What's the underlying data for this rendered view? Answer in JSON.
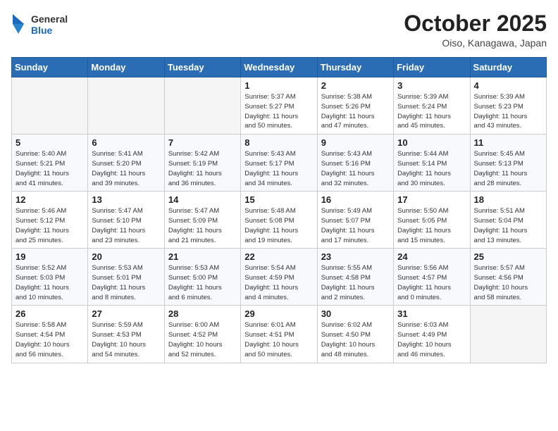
{
  "header": {
    "logo_general": "General",
    "logo_blue": "Blue",
    "month_title": "October 2025",
    "location": "Oiso, Kanagawa, Japan"
  },
  "weekdays": [
    "Sunday",
    "Monday",
    "Tuesday",
    "Wednesday",
    "Thursday",
    "Friday",
    "Saturday"
  ],
  "weeks": [
    [
      {
        "day": "",
        "info": ""
      },
      {
        "day": "",
        "info": ""
      },
      {
        "day": "",
        "info": ""
      },
      {
        "day": "1",
        "info": "Sunrise: 5:37 AM\nSunset: 5:27 PM\nDaylight: 11 hours\nand 50 minutes."
      },
      {
        "day": "2",
        "info": "Sunrise: 5:38 AM\nSunset: 5:26 PM\nDaylight: 11 hours\nand 47 minutes."
      },
      {
        "day": "3",
        "info": "Sunrise: 5:39 AM\nSunset: 5:24 PM\nDaylight: 11 hours\nand 45 minutes."
      },
      {
        "day": "4",
        "info": "Sunrise: 5:39 AM\nSunset: 5:23 PM\nDaylight: 11 hours\nand 43 minutes."
      }
    ],
    [
      {
        "day": "5",
        "info": "Sunrise: 5:40 AM\nSunset: 5:21 PM\nDaylight: 11 hours\nand 41 minutes."
      },
      {
        "day": "6",
        "info": "Sunrise: 5:41 AM\nSunset: 5:20 PM\nDaylight: 11 hours\nand 39 minutes."
      },
      {
        "day": "7",
        "info": "Sunrise: 5:42 AM\nSunset: 5:19 PM\nDaylight: 11 hours\nand 36 minutes."
      },
      {
        "day": "8",
        "info": "Sunrise: 5:43 AM\nSunset: 5:17 PM\nDaylight: 11 hours\nand 34 minutes."
      },
      {
        "day": "9",
        "info": "Sunrise: 5:43 AM\nSunset: 5:16 PM\nDaylight: 11 hours\nand 32 minutes."
      },
      {
        "day": "10",
        "info": "Sunrise: 5:44 AM\nSunset: 5:14 PM\nDaylight: 11 hours\nand 30 minutes."
      },
      {
        "day": "11",
        "info": "Sunrise: 5:45 AM\nSunset: 5:13 PM\nDaylight: 11 hours\nand 28 minutes."
      }
    ],
    [
      {
        "day": "12",
        "info": "Sunrise: 5:46 AM\nSunset: 5:12 PM\nDaylight: 11 hours\nand 25 minutes."
      },
      {
        "day": "13",
        "info": "Sunrise: 5:47 AM\nSunset: 5:10 PM\nDaylight: 11 hours\nand 23 minutes."
      },
      {
        "day": "14",
        "info": "Sunrise: 5:47 AM\nSunset: 5:09 PM\nDaylight: 11 hours\nand 21 minutes."
      },
      {
        "day": "15",
        "info": "Sunrise: 5:48 AM\nSunset: 5:08 PM\nDaylight: 11 hours\nand 19 minutes."
      },
      {
        "day": "16",
        "info": "Sunrise: 5:49 AM\nSunset: 5:07 PM\nDaylight: 11 hours\nand 17 minutes."
      },
      {
        "day": "17",
        "info": "Sunrise: 5:50 AM\nSunset: 5:05 PM\nDaylight: 11 hours\nand 15 minutes."
      },
      {
        "day": "18",
        "info": "Sunrise: 5:51 AM\nSunset: 5:04 PM\nDaylight: 11 hours\nand 13 minutes."
      }
    ],
    [
      {
        "day": "19",
        "info": "Sunrise: 5:52 AM\nSunset: 5:03 PM\nDaylight: 11 hours\nand 10 minutes."
      },
      {
        "day": "20",
        "info": "Sunrise: 5:53 AM\nSunset: 5:01 PM\nDaylight: 11 hours\nand 8 minutes."
      },
      {
        "day": "21",
        "info": "Sunrise: 5:53 AM\nSunset: 5:00 PM\nDaylight: 11 hours\nand 6 minutes."
      },
      {
        "day": "22",
        "info": "Sunrise: 5:54 AM\nSunset: 4:59 PM\nDaylight: 11 hours\nand 4 minutes."
      },
      {
        "day": "23",
        "info": "Sunrise: 5:55 AM\nSunset: 4:58 PM\nDaylight: 11 hours\nand 2 minutes."
      },
      {
        "day": "24",
        "info": "Sunrise: 5:56 AM\nSunset: 4:57 PM\nDaylight: 11 hours\nand 0 minutes."
      },
      {
        "day": "25",
        "info": "Sunrise: 5:57 AM\nSunset: 4:56 PM\nDaylight: 10 hours\nand 58 minutes."
      }
    ],
    [
      {
        "day": "26",
        "info": "Sunrise: 5:58 AM\nSunset: 4:54 PM\nDaylight: 10 hours\nand 56 minutes."
      },
      {
        "day": "27",
        "info": "Sunrise: 5:59 AM\nSunset: 4:53 PM\nDaylight: 10 hours\nand 54 minutes."
      },
      {
        "day": "28",
        "info": "Sunrise: 6:00 AM\nSunset: 4:52 PM\nDaylight: 10 hours\nand 52 minutes."
      },
      {
        "day": "29",
        "info": "Sunrise: 6:01 AM\nSunset: 4:51 PM\nDaylight: 10 hours\nand 50 minutes."
      },
      {
        "day": "30",
        "info": "Sunrise: 6:02 AM\nSunset: 4:50 PM\nDaylight: 10 hours\nand 48 minutes."
      },
      {
        "day": "31",
        "info": "Sunrise: 6:03 AM\nSunset: 4:49 PM\nDaylight: 10 hours\nand 46 minutes."
      },
      {
        "day": "",
        "info": ""
      }
    ]
  ]
}
